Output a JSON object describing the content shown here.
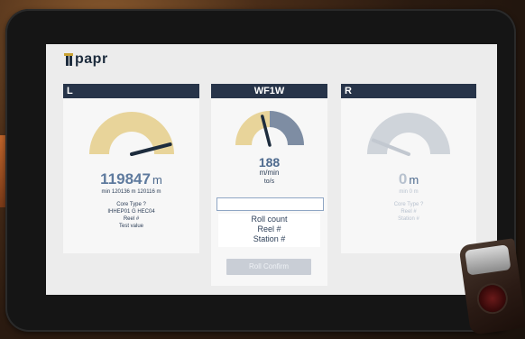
{
  "logo": {
    "text": "papr"
  },
  "panels": {
    "left": {
      "header": "L",
      "value": "119847",
      "unit": "m",
      "range": "min 120136 m 120116 m",
      "lines": [
        "Core Type ?",
        "IHHEP01 G   HEC04",
        "Reel #",
        "Test value"
      ],
      "gauge_level": 0.92
    },
    "center": {
      "header": "WF1W",
      "value": "188",
      "unit": "m/min",
      "sub": "to/s",
      "input_value": "",
      "info": [
        "Roll count",
        "Reel #",
        "Station #"
      ],
      "button_label": "Roll Confirm",
      "gauge_level": 0.42
    },
    "right": {
      "header": "R",
      "value": "0",
      "unit": "m",
      "range": "min 0 m",
      "lines": [
        "Core Type ?",
        "Reel #",
        "Station #"
      ],
      "gauge_level": 0.12
    }
  },
  "colors": {
    "header_bg": "#273449",
    "gauge_gold": "#e8d49a",
    "gauge_slate": "#7e8da3",
    "gauge_dim": "#cfd4da",
    "value_blue": "#5e7a9e"
  }
}
